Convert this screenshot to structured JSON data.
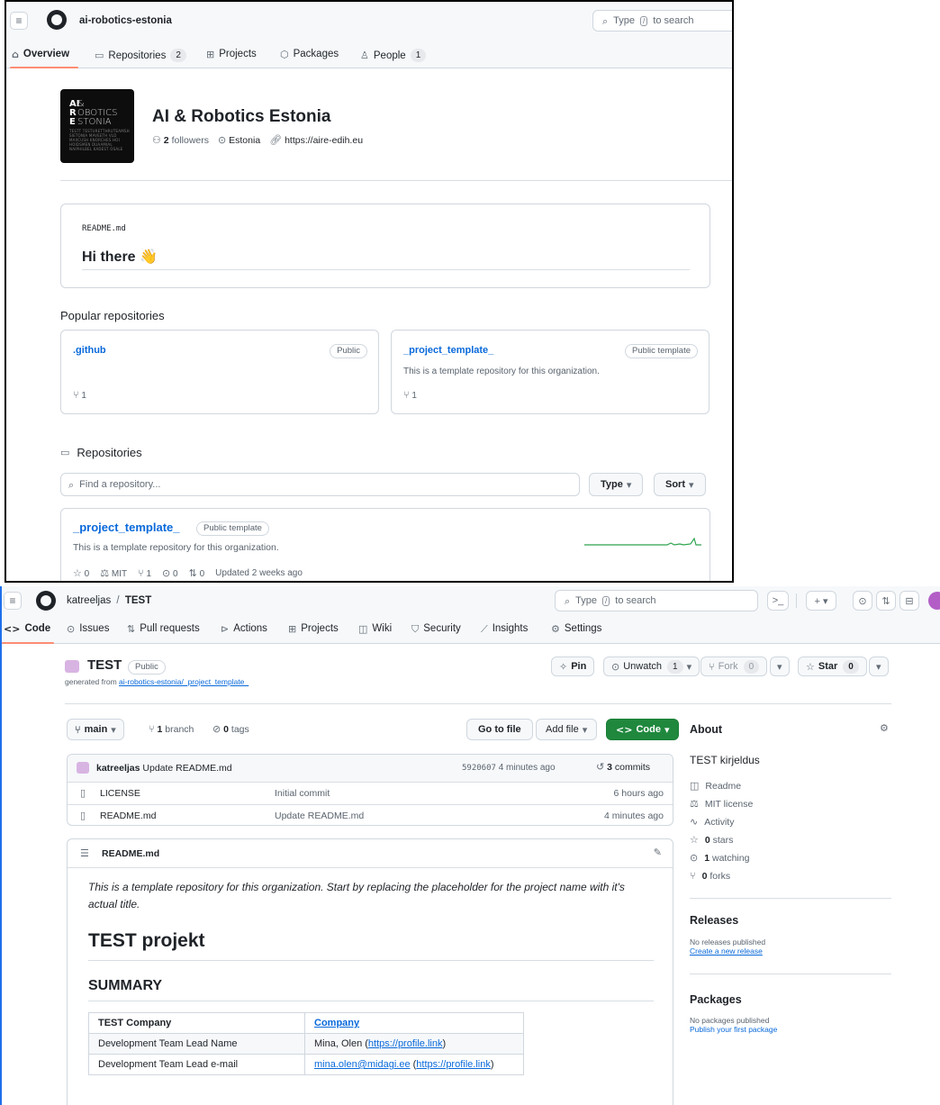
{
  "colors": {
    "accent": "#0969da",
    "tab_underline": "#fd8c73",
    "code_button": "#1f883d",
    "border": "#d0d7de",
    "sparkline": "#2da44e"
  },
  "org_page": {
    "org_slug": "ai-robotics-estonia",
    "search_placeholder": "Type",
    "search_suffix": "to search",
    "search_key": "/",
    "tabs": [
      {
        "label": "Overview",
        "icon": "home-icon"
      },
      {
        "label": "Repositories",
        "count": "2",
        "icon": "repo-icon"
      },
      {
        "label": "Projects",
        "icon": "table-icon"
      },
      {
        "label": "Packages",
        "icon": "package-icon"
      },
      {
        "label": "People",
        "count": "1",
        "icon": "person-icon"
      }
    ],
    "avatar": {
      "line1": "AI",
      "line2": "R",
      "line3": "E",
      "word1": "&",
      "word2": "OBOTICS",
      "word3": "STONIA",
      "fine_print": "TESTT TESTURETTHRUTEAMSH SIETONIA MAVEETH VLD MAXCUSH KNORCHES HOI HOIDSMEN DUAAMIAL NAIPHILBEL KADEST OSALE"
    },
    "name": "AI & Robotics Estonia",
    "followers_count": "2",
    "followers_label": "followers",
    "location": "Estonia",
    "website": "https://aire-edih.eu",
    "readme": {
      "filename": "README.md",
      "heading": "Hi there",
      "emoji": "👋"
    },
    "popular_title": "Popular repositories",
    "popular": [
      {
        "name": ".github",
        "visibility": "Public",
        "description": "",
        "forks": "1"
      },
      {
        "name": "_project_template_",
        "visibility": "Public template",
        "description": "This is a template repository for this organization.",
        "forks": "1"
      }
    ],
    "repositories_title": "Repositories",
    "find_placeholder": "Find a repository...",
    "type_button": "Type",
    "sort_button": "Sort",
    "repo_item": {
      "name": "_project_template_",
      "visibility": "Public template",
      "description": "This is a template repository for this organization.",
      "stars": "0",
      "license": "MIT",
      "forks": "1",
      "issues": "0",
      "pulls": "0",
      "updated": "Updated 2 weeks ago"
    }
  },
  "repo_page": {
    "owner": "katreeljas",
    "separator": "/",
    "repo": "TEST",
    "search_placeholder": "Type",
    "search_suffix": "to search",
    "search_key": "/",
    "tabs": [
      {
        "label": "Code",
        "icon": "code-icon"
      },
      {
        "label": "Issues",
        "icon": "issue-icon"
      },
      {
        "label": "Pull requests",
        "icon": "pull-request-icon"
      },
      {
        "label": "Actions",
        "icon": "play-icon"
      },
      {
        "label": "Projects",
        "icon": "table-icon"
      },
      {
        "label": "Wiki",
        "icon": "book-icon"
      },
      {
        "label": "Security",
        "icon": "shield-icon"
      },
      {
        "label": "Insights",
        "icon": "graph-icon"
      },
      {
        "label": "Settings",
        "icon": "gear-icon"
      }
    ],
    "title": "TEST",
    "visibility": "Public",
    "generated_from_prefix": "generated from",
    "generated_from_link": "ai-robotics-estonia/_project_template_",
    "pin_label": "Pin",
    "unwatch_label": "Unwatch",
    "watch_count": "1",
    "fork_label": "Fork",
    "fork_count": "0",
    "star_label": "Star",
    "star_count": "0",
    "branch": "main",
    "branches_count": "1",
    "branches_label": "branch",
    "tags_count": "0",
    "tags_label": "tags",
    "go_to_file": "Go to file",
    "add_file": "Add file",
    "code_button": "Code",
    "latest_commit": {
      "author": "katreeljas",
      "message": "Update README.md",
      "sha": "5920607",
      "time": "4 minutes ago",
      "commits_count": "3",
      "commits_label": "commits"
    },
    "files": [
      {
        "name": "LICENSE",
        "message": "Initial commit",
        "time": "6 hours ago"
      },
      {
        "name": "README.md",
        "message": "Update README.md",
        "time": "4 minutes ago"
      }
    ],
    "readme": {
      "filename": "README.md",
      "intro": "This is a template repository for this organization. Start by replacing the placeholder for the project name with it's actual title.",
      "h1": "TEST projekt",
      "h2": "SUMMARY",
      "table": [
        {
          "key": "TEST Company",
          "value": "Company",
          "link": ""
        },
        {
          "key": "Development Team Lead Name",
          "value": "Mina, Olen (",
          "link": "https://profile.link",
          "suffix": ")"
        },
        {
          "key": "Development Team Lead e-mail",
          "value": "mina.olen@midagi.ee",
          "link": "https://profile.link",
          "suffix": ")",
          "prefix_after": " ("
        }
      ]
    },
    "about": {
      "title": "About",
      "description": "TEST kirjeldus",
      "items": [
        {
          "icon": "book-icon",
          "label": "Readme"
        },
        {
          "icon": "law-icon",
          "label": "MIT license"
        },
        {
          "icon": "pulse-icon",
          "label": "Activity"
        },
        {
          "icon": "star-icon",
          "count": "0",
          "label": "stars"
        },
        {
          "icon": "eye-icon",
          "count": "1",
          "label": "watching"
        },
        {
          "icon": "fork-icon",
          "count": "0",
          "label": "forks"
        }
      ]
    },
    "releases": {
      "title": "Releases",
      "text": "No releases published",
      "link": "Create a new release"
    },
    "packages": {
      "title": "Packages",
      "text": "No packages published",
      "link": "Publish your first package"
    }
  }
}
